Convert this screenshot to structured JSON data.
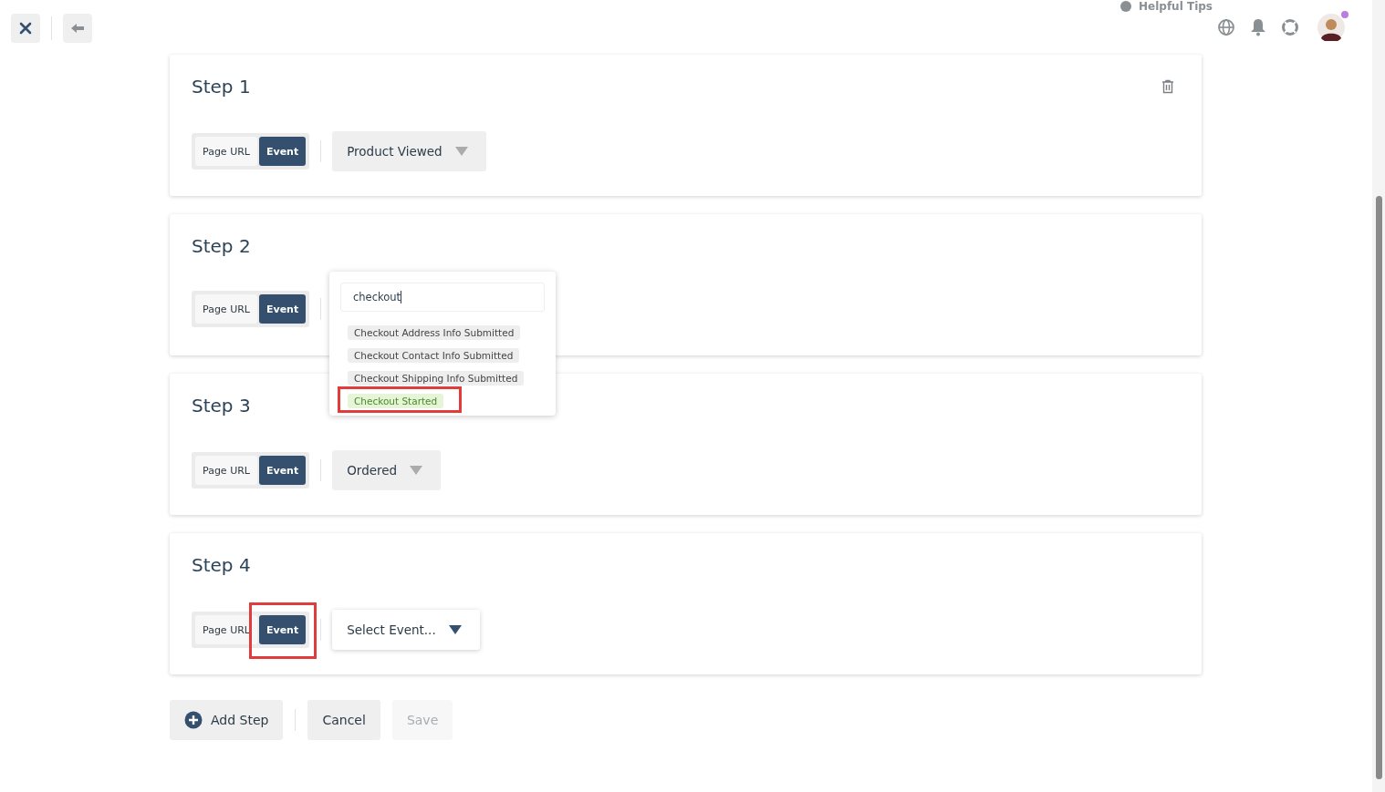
{
  "header": {
    "helpful_tips": "Helpful Tips",
    "notification_dot": true
  },
  "steps": [
    {
      "title": "Step 1",
      "deletable": true,
      "toggle": [
        {
          "label": "Page URL",
          "selected": false,
          "highlighted": false
        },
        {
          "label": "Event",
          "selected": true,
          "highlighted": false
        }
      ],
      "select": {
        "kind": "value",
        "text": "Product Viewed"
      }
    },
    {
      "title": "Step 2",
      "deletable": false,
      "toggle": [
        {
          "label": "Page URL",
          "selected": false,
          "highlighted": false
        },
        {
          "label": "Event",
          "selected": true,
          "highlighted": false
        }
      ],
      "dropdown": {
        "search": "checkout",
        "options": [
          {
            "label": "Checkout Address Info Submitted",
            "matched": false,
            "highlighted": false
          },
          {
            "label": "Checkout Contact Info Submitted",
            "matched": false,
            "highlighted": false
          },
          {
            "label": "Checkout Shipping Info Submitted",
            "matched": false,
            "highlighted": false
          },
          {
            "label": "Checkout Started",
            "matched": true,
            "highlighted": true
          }
        ]
      }
    },
    {
      "title": "Step 3",
      "deletable": false,
      "toggle": [
        {
          "label": "Page URL",
          "selected": false,
          "highlighted": false
        },
        {
          "label": "Event",
          "selected": true,
          "highlighted": false
        }
      ],
      "select": {
        "kind": "value",
        "text": "Ordered"
      }
    },
    {
      "title": "Step 4",
      "deletable": false,
      "toggle": [
        {
          "label": "Page URL",
          "selected": false,
          "highlighted": false
        },
        {
          "label": "Event",
          "selected": true,
          "highlighted": true
        }
      ],
      "select": {
        "kind": "placeholder",
        "text": "Select Event..."
      }
    }
  ],
  "actions": [
    {
      "kind": "add",
      "label": "Add Step",
      "disabled": false
    },
    {
      "kind": "cancel",
      "label": "Cancel",
      "disabled": false
    },
    {
      "kind": "save",
      "label": "Save",
      "disabled": true
    }
  ]
}
